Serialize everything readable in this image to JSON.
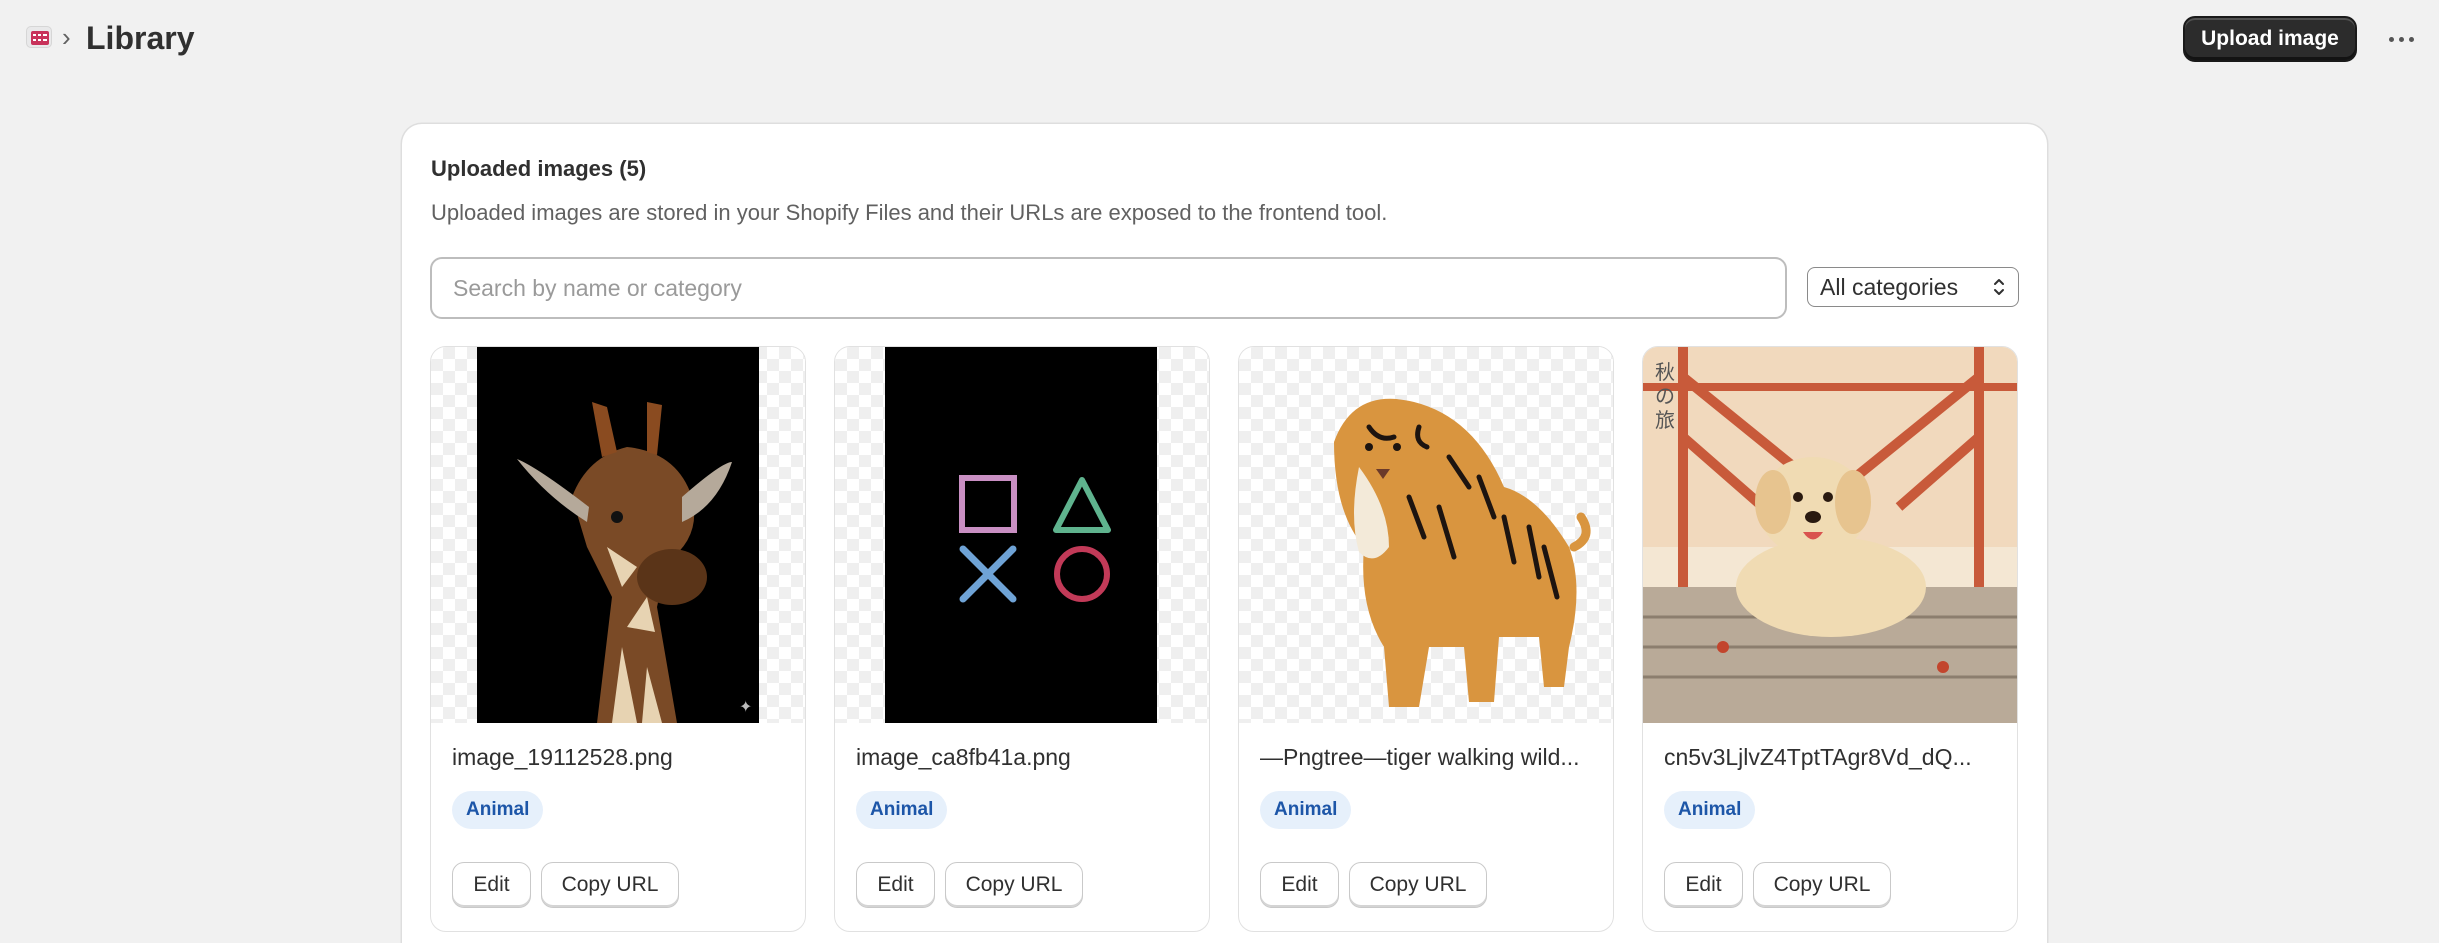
{
  "header": {
    "breadcrumb_chevron": "›",
    "title": "Library",
    "upload_label": "Upload image"
  },
  "card": {
    "title": "Uploaded images (5)",
    "description": "Uploaded images are stored in your Shopify Files and their URLs are exposed to the frontend tool.",
    "search_placeholder": "Search by name or category",
    "category_selected": "All categories"
  },
  "images": [
    {
      "file_name": "image_19112528.png",
      "category": "Animal",
      "edit_label": "Edit",
      "copy_label": "Copy URL",
      "picture": "giraffe"
    },
    {
      "file_name": "image_ca8fb41a.png",
      "category": "Animal",
      "edit_label": "Edit",
      "copy_label": "Copy URL",
      "picture": "playstation-symbols"
    },
    {
      "file_name": "—Pngtree—tiger walking wild...",
      "category": "Animal",
      "edit_label": "Edit",
      "copy_label": "Copy URL",
      "picture": "tiger"
    },
    {
      "file_name": "cn5v3LjlvZ4TptTAgr8Vd_dQ...",
      "category": "Animal",
      "edit_label": "Edit",
      "copy_label": "Copy URL",
      "picture": "dog-on-bridge"
    }
  ],
  "colors": {
    "primary_button": "#2c2c2c",
    "badge_bg": "#e6f0fb",
    "badge_text": "#1d56a8",
    "page_bg": "#f1f1f1"
  }
}
